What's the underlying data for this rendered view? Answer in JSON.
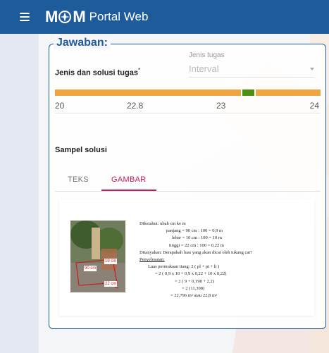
{
  "header": {
    "logo_text_left": "M",
    "logo_text_right": "M",
    "title": "Portal Web",
    "brand_color": "#1e5b9a"
  },
  "answer": {
    "legend": "Jawaban:",
    "task_type_label": "Jenis dan solusi tugas",
    "required_mark": "*",
    "select": {
      "caption": "Jenis tugas",
      "value": "Interval"
    },
    "range": {
      "values": [
        "20",
        "22.8",
        "23",
        "24"
      ],
      "numbers": [
        20,
        22.8,
        23,
        24
      ],
      "colors": {
        "outer": "#f0a640",
        "inner": "#4e8f12"
      }
    },
    "sample_label": "Sampel solusi",
    "tabs": [
      {
        "label": "TEKS",
        "active": false
      },
      {
        "label": "GAMBAR",
        "active": true
      }
    ],
    "solution_image": {
      "photo_tags": [
        "19 cm",
        "90 cm",
        "22 cm"
      ],
      "lines": [
        "Diketahui: ubah cm ke m",
        "panjang = 90 cm : 100 = 0,9 m",
        "lebar = 10 cm : 100 = 10 m",
        "tinggi = 22 cm : 100 = 0,22 m",
        "Ditanyakan: Berapakah luas yang akan dicat oleh tukang cat?",
        "Penyelesaian:",
        "Luas permukaan tiang: 2 ( pl + pt + lt )",
        "= 2 ( 0,9 x 10 + 0,9 x 0,22 + 10 x 0,22)",
        "= 2 ( 9 + 0,198 + 2,2)",
        "= 2 (11,398)",
        "= 22,796 m² atau 22,8 m²"
      ]
    }
  }
}
